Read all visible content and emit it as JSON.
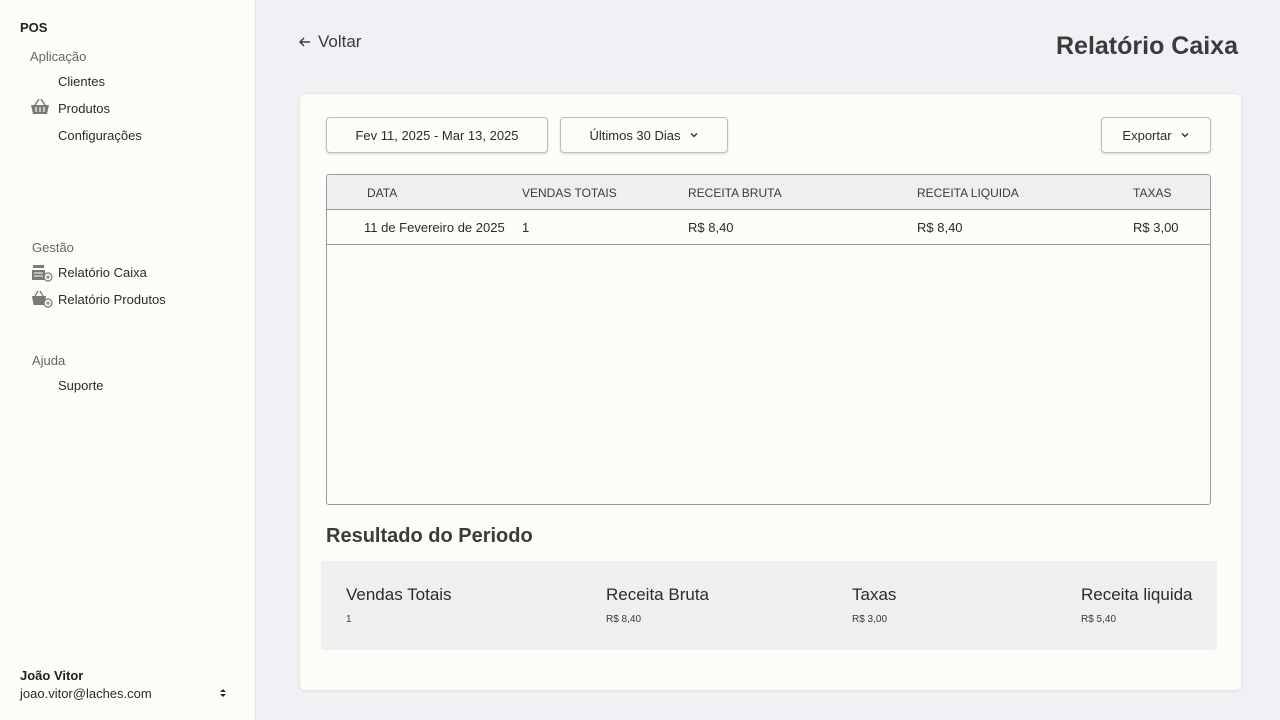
{
  "sidebar": {
    "brand": "POS",
    "groups": [
      {
        "label": "Aplicação",
        "items": [
          {
            "label": "Clientes",
            "icon": ""
          },
          {
            "label": "Produtos",
            "icon": "basket-icon"
          },
          {
            "label": "Configurações",
            "icon": ""
          }
        ]
      },
      {
        "label": "Gestão",
        "items": [
          {
            "label": "Relatório Caixa",
            "icon": "cash-register-report-icon"
          },
          {
            "label": "Relatório Produtos",
            "icon": "basket-report-icon"
          }
        ]
      },
      {
        "label": "Ajuda",
        "items": [
          {
            "label": "Suporte",
            "icon": ""
          }
        ]
      }
    ],
    "user": {
      "name": "João Vitor",
      "email": "joao.vitor@laches.com"
    }
  },
  "header": {
    "back_label": "Voltar",
    "title": "Relatório Caixa"
  },
  "filters": {
    "date_range": "Fev 11, 2025 - Mar 13, 2025",
    "period": "Últimos 30 Dias",
    "export_label": "Exportar"
  },
  "table": {
    "columns": [
      "DATA",
      "VENDAS TOTAIS",
      "RECEITA BRUTA",
      "RECEITA LIQUIDA",
      "TAXAS"
    ],
    "rows": [
      [
        "11 de Fevereiro de 2025",
        "1",
        "R$ 8,40",
        "R$ 8,40",
        "R$ 3,00"
      ]
    ]
  },
  "summary": {
    "title": "Resultado do Periodo",
    "items": [
      {
        "label": "Vendas Totais",
        "value": "1"
      },
      {
        "label": "Receita Bruta",
        "value": "R$ 8,40"
      },
      {
        "label": "Taxas",
        "value": "R$ 3,00"
      },
      {
        "label": "Receita liquida",
        "value": "R$ 5,40"
      }
    ]
  },
  "colors": {
    "sidebar_bg": "#fbfdf7",
    "page_bg": "#f0f1f4",
    "header_row_bg": "#eeefee"
  }
}
